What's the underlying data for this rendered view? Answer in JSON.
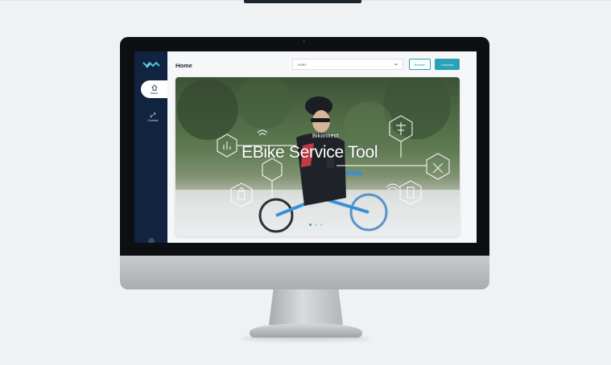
{
  "app": {
    "header_title": "Home"
  },
  "sidebar": {
    "items": [
      {
        "label": "Home",
        "icon": "home-icon"
      },
      {
        "label": "Connect",
        "icon": "link-icon"
      }
    ]
  },
  "toolbar": {
    "port_select_value": "PORT",
    "refresh_label": "Refresh",
    "connect_label": "Connect"
  },
  "hero": {
    "subtitle": "Bikonnect",
    "title": "EBike Service Tool",
    "slide_count": 3,
    "active_slide": 1
  },
  "colors": {
    "sidebar": "#10233f",
    "accent": "#2aa2b6",
    "monitor_frame": "#0d0f12"
  }
}
